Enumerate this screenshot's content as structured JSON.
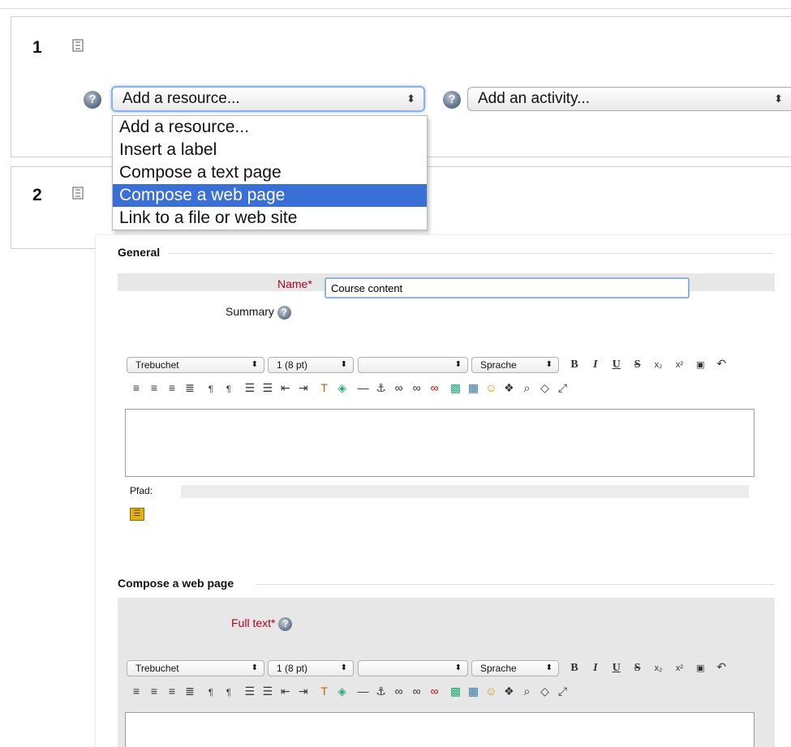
{
  "sections": [
    {
      "number": "1"
    },
    {
      "number": "2"
    }
  ],
  "resource_select": {
    "selected": "Add a resource..."
  },
  "activity_select": {
    "selected": "Add an activity..."
  },
  "resource_menu": {
    "items": [
      "Add a resource...",
      "Insert a label",
      "Compose a text page",
      "Compose a web page",
      "Link to a file or web site"
    ],
    "highlighted_index": 3
  },
  "form": {
    "general_legend": "General",
    "name_label": "Name",
    "required_mark": "*",
    "name_value": "Course content",
    "summary_label": "Summary",
    "compose_legend": "Compose a web page",
    "fulltext_label": "Full text",
    "path_label": "Pfad:"
  },
  "editor": {
    "font": "Trebuchet",
    "size": "1 (8 pt)",
    "format": "",
    "language": "Sprache",
    "buttons": {
      "bold": "B",
      "italic": "I",
      "underline": "U",
      "strike": "S",
      "sub": "x₂",
      "sup": "x²",
      "undo": "↶"
    }
  },
  "colors": {
    "highlight": "#3a6fd8",
    "required": "#b00020",
    "focus": "#8bb3e6"
  }
}
